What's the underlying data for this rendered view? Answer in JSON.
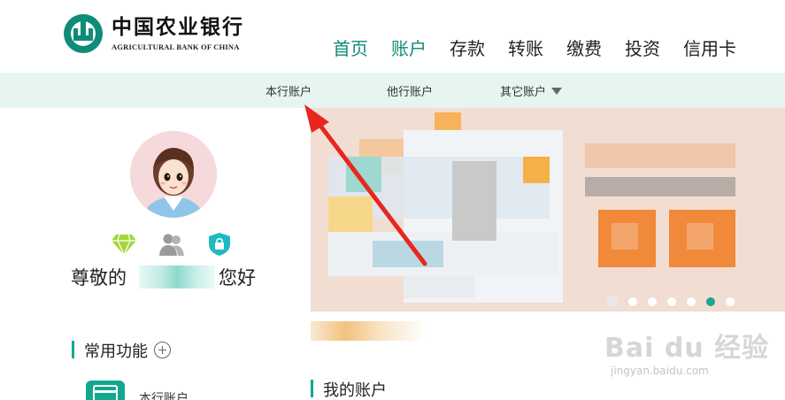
{
  "brand": {
    "name_cn": "中国农业银行",
    "name_en": "AGRICULTURAL BANK OF CHINA",
    "color": "#0e8c78"
  },
  "nav": {
    "items": [
      {
        "label": "首页",
        "active": true
      },
      {
        "label": "账户",
        "active": false
      },
      {
        "label": "存款",
        "active": false
      },
      {
        "label": "转账",
        "active": false
      },
      {
        "label": "缴费",
        "active": false
      },
      {
        "label": "投资",
        "active": false
      },
      {
        "label": "信用卡",
        "active": false
      }
    ]
  },
  "subnav": {
    "items": [
      {
        "label": "本行账户"
      },
      {
        "label": "他行账户"
      },
      {
        "label": "其它账户"
      }
    ]
  },
  "profile": {
    "greeting_prefix": "尊敬的",
    "greeting_suffix": "您好",
    "badges": [
      "diamond-icon",
      "user-group-icon",
      "shield-lock-icon"
    ]
  },
  "sections": {
    "common_functions": "常用功能",
    "my_accounts": "我的账户"
  },
  "functions": [
    {
      "label": "本行账户",
      "icon": "card-icon"
    }
  ],
  "banner": {
    "dot_count": 7,
    "active_dot": 6
  },
  "watermark": {
    "main": "Bai du 经验",
    "sub": "jingyan.baidu.com"
  },
  "colors": {
    "accent": "#0fa990",
    "subnav_bg": "#e6f5f2",
    "banner_bg": "#f2ddd3",
    "annotation_arrow": "#e8261f"
  }
}
